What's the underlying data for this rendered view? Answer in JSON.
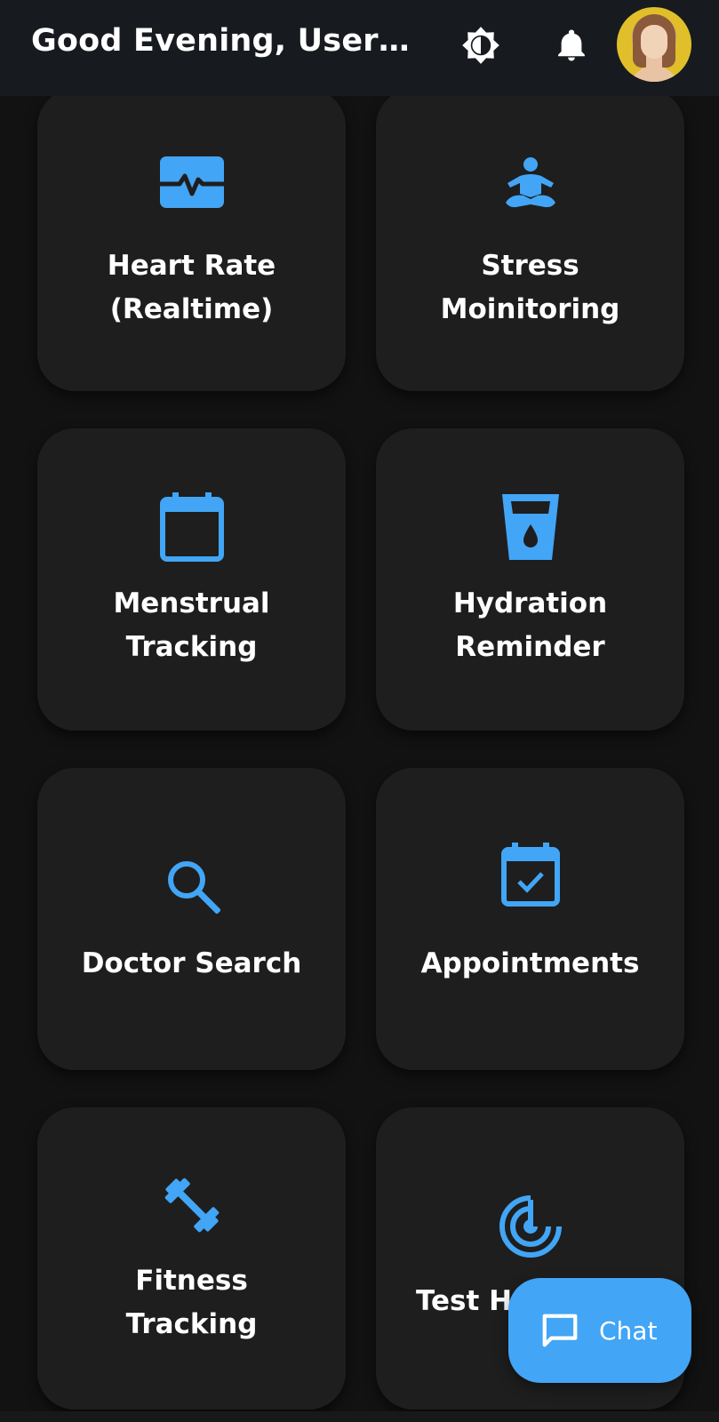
{
  "header": {
    "greeting": "Good Evening, User_...",
    "theme_icon": "brightness-icon",
    "notifications_icon": "bell-icon",
    "avatar": "user-avatar"
  },
  "colors": {
    "accent": "#42a5f5",
    "card": "#1e1e1e",
    "background": "#121212",
    "app_bar": "#171b1f"
  },
  "cards": [
    {
      "icon": "heart-monitor-icon",
      "lines": [
        "Heart Rate",
        "(Realtime)"
      ]
    },
    {
      "icon": "meditation-icon",
      "lines": [
        "Stress",
        "Moinitoring"
      ]
    },
    {
      "icon": "calendar-icon",
      "lines": [
        "Menstrual",
        "Tracking"
      ]
    },
    {
      "icon": "water-glass-icon",
      "lines": [
        "Hydration",
        "Reminder"
      ]
    },
    {
      "icon": "search-icon",
      "lines": [
        "Doctor Search"
      ]
    },
    {
      "icon": "calendar-check-icon",
      "lines": [
        "Appointments"
      ]
    },
    {
      "icon": "dumbbell-icon",
      "lines": [
        "Fitness",
        "Tracking"
      ]
    },
    {
      "icon": "radar-icon",
      "lines": [
        "Test H"
      ]
    }
  ],
  "fab": {
    "icon": "chat-icon",
    "label": "Chat"
  }
}
